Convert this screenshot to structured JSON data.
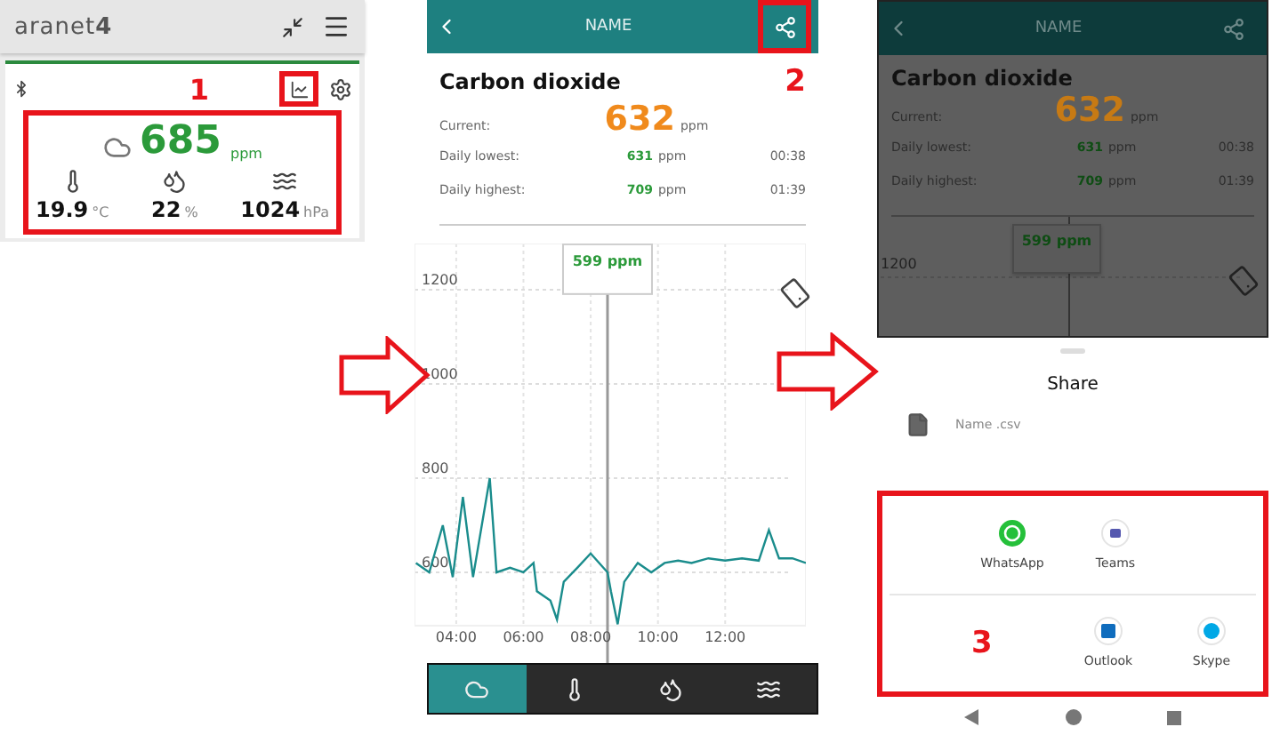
{
  "overview": {
    "app_name": "aranet**4**",
    "marker": "1",
    "co2": {
      "value": "685",
      "unit": "ppm"
    },
    "readings": [
      {
        "kind": "temperature",
        "value": "19.9",
        "unit": "°C"
      },
      {
        "kind": "humidity",
        "value": "22",
        "unit": "%"
      },
      {
        "kind": "pressure",
        "value": "1024",
        "unit": "hPa"
      }
    ]
  },
  "history": {
    "title": "NAME",
    "marker": "2",
    "heading": "Carbon dioxide",
    "current": {
      "label": "Current:",
      "value": "632",
      "unit": "ppm"
    },
    "stats": [
      {
        "label": "Daily lowest:",
        "value": "631",
        "unit": "ppm",
        "time": "00:38"
      },
      {
        "label": "Daily highest:",
        "value": "709",
        "unit": "ppm",
        "time": "01:39"
      }
    ],
    "chart_data": {
      "type": "line",
      "grid": true,
      "xlim": [
        2.76,
        14.4
      ],
      "ylim": [
        487,
        1298
      ],
      "ref_lines": [
        {
          "axis": "x",
          "value": 8.5,
          "color": "#999999"
        }
      ],
      "annotations": [
        {
          "x": 8.5,
          "y": 1270,
          "text": "599 ppm"
        }
      ],
      "x": [
        2.8,
        3.2,
        3.6,
        3.9,
        4.2,
        4.5,
        5.0,
        5.2,
        5.6,
        6.0,
        6.3,
        6.4,
        6.8,
        7.0,
        7.2,
        7.6,
        8.0,
        8.5,
        8.6,
        8.8,
        9.0,
        9.4,
        9.8,
        10.2,
        10.6,
        11.0,
        11.5,
        12.0,
        12.5,
        13.0,
        13.3,
        13.6,
        14.0,
        14.4
      ],
      "series": [
        {
          "color": "#1a8c8c",
          "values": [
            620,
            600,
            700,
            590,
            760,
            590,
            800,
            600,
            610,
            600,
            620,
            560,
            540,
            500,
            580,
            610,
            640,
            600,
            560,
            490,
            580,
            620,
            600,
            620,
            625,
            620,
            630,
            625,
            630,
            625,
            690,
            630,
            630,
            620
          ]
        }
      ],
      "xticks": [
        {
          "value": 4,
          "label": "04:00"
        },
        {
          "value": 6,
          "label": "06:00"
        },
        {
          "value": 8,
          "label": "08:00"
        },
        {
          "value": 10,
          "label": "10:00"
        },
        {
          "value": 12,
          "label": "12:00"
        }
      ],
      "yticks": [
        600,
        800,
        1000,
        1200
      ]
    },
    "tabs": [
      {
        "kind": "co2",
        "selected": true
      },
      {
        "kind": "temperature",
        "selected": false
      },
      {
        "kind": "humidity",
        "selected": false
      },
      {
        "kind": "pressure",
        "selected": false
      }
    ]
  },
  "share_screen": {
    "title": "NAME",
    "heading": "Carbon dioxide",
    "current": {
      "label": "Current:",
      "value": "632",
      "unit": "ppm"
    },
    "stats": [
      {
        "label": "Daily lowest:",
        "value": "631",
        "unit": "ppm",
        "time": "00:38"
      },
      {
        "label": "Daily highest:",
        "value": "709",
        "unit": "ppm",
        "time": "01:39"
      }
    ],
    "y_label": "1200",
    "tooltip": "599 ppm",
    "sheet": {
      "title": "Share",
      "file_name": "Name .csv",
      "marker": "3",
      "app_rows": [
        {
          "apps": [
            {
              "kind": "whatsapp",
              "label": "WhatsApp"
            },
            {
              "kind": "teams",
              "label": "Teams"
            }
          ]
        },
        {
          "apps": [
            {
              "kind": "outlook",
              "label": "Outlook"
            },
            {
              "kind": "skype",
              "label": "Skype"
            }
          ]
        }
      ]
    }
  }
}
